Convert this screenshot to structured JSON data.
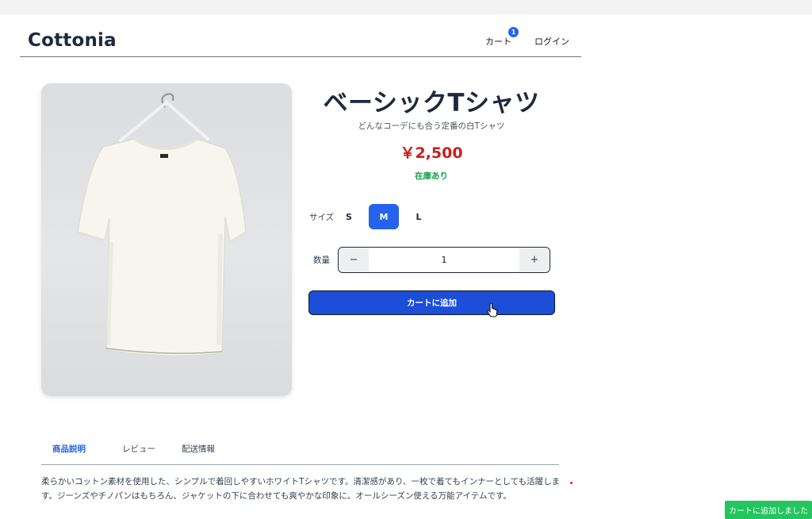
{
  "header": {
    "logo": "Cottonia",
    "nav": {
      "cart_label": "カート",
      "cart_count": "1",
      "login_label": "ログイン"
    }
  },
  "product": {
    "image_icon": "white-tshirt-on-hanger",
    "title": "ベーシックTシャツ",
    "subtitle": "どんなコーデにも合う定番の白Tシャツ",
    "price": "￥2,500",
    "stock_status": "在庫あり",
    "size": {
      "label": "サイズ",
      "options": [
        "S",
        "M",
        "L"
      ],
      "selected": "M"
    },
    "quantity": {
      "label": "数量",
      "value": "1",
      "minus_icon": "minus-icon",
      "plus_icon": "plus-icon"
    },
    "add_to_cart_label": "カートに追加"
  },
  "tabs": {
    "items": [
      {
        "label": "商品説明",
        "active": true
      },
      {
        "label": "レビュー",
        "active": false
      },
      {
        "label": "配送情報",
        "active": false
      }
    ],
    "description": "柔らかいコットン素材を使用した、シンプルで着回しやすいホワイトTシャツです。清潔感があり、一枚で着てもインナーとしても活躍します。ジーンズやチノパンはもちろん、ジャケットの下に合わせても爽やかな印象に。オールシーズン使える万能アイテムです。"
  },
  "toast": {
    "message": "カートに追加しました"
  },
  "colors": {
    "accent": "#2563eb",
    "button": "#1d4ed8",
    "price": "#c81e1e",
    "stock": "#16a34a",
    "toast": "#22c55e",
    "text": "#1e293b"
  }
}
